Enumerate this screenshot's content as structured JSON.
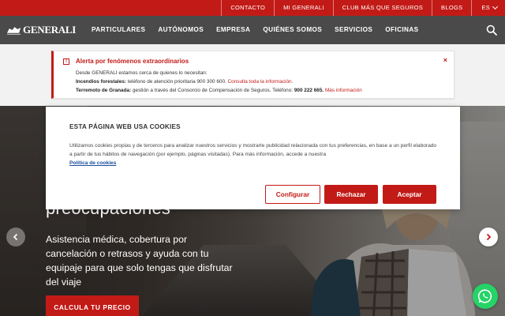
{
  "topbar": {
    "links": [
      "CONTACTO",
      "MI GENERALI",
      "CLUB MÁS QUE SEGUROS",
      "BLOGS"
    ],
    "language": "ES"
  },
  "nav": {
    "brand": "GENERALI",
    "items": [
      "PARTICULARES",
      "AUTÓNOMOS",
      "EMPRESA",
      "QUIÉNES SOMOS",
      "SERVICIOS",
      "OFICINAS"
    ],
    "search_icon": "search-icon"
  },
  "alert": {
    "title": "Alerta por fenómenos extraordinarios",
    "intro": "Desde GENERALI estamos cerca de quienes lo necesitan:",
    "line1_label": "Incendios forestales:",
    "line1_text": " teléfono de atención prioritaria 900 300 600.",
    "line1_link": " Consulta toda la información.",
    "line2_label": "Terremoto de Granada:",
    "line2_text": " gestión a través del Consorcio de Compensación de Seguros. Teléfono: ",
    "line2_phone": "900 222 665.",
    "line2_link": " Más información",
    "close": "×"
  },
  "hero": {
    "heading": "preocupaciones",
    "text": "Asistencia médica, cobertura por cancelación o retrasos y ayuda con tu equipaje para que solo tengas que disfrutar del viaje",
    "cta": "CALCULA TU PRECIO"
  },
  "cookie": {
    "title": "ESTA PÁGINA WEB USA COOKIES",
    "text": "Utilizamos cookies propias y de terceros para analizar nuestros servicios y mostrarte publicidad relacionada con tus preferencias, en base a un perfil elaborado a partir de tus hábitos de navegación (por ejemplo, páginas visitadas). Para más información, accede a nuestra",
    "policy_link": "Política de cookies",
    "configure": "Configurar",
    "reject": "Rechazar",
    "accept": "Aceptar"
  },
  "colors": {
    "brand_red": "#c21b17",
    "nav_grey": "#4a4a4a",
    "link_blue": "#1a4d9c",
    "whatsapp_green": "#25d366"
  }
}
